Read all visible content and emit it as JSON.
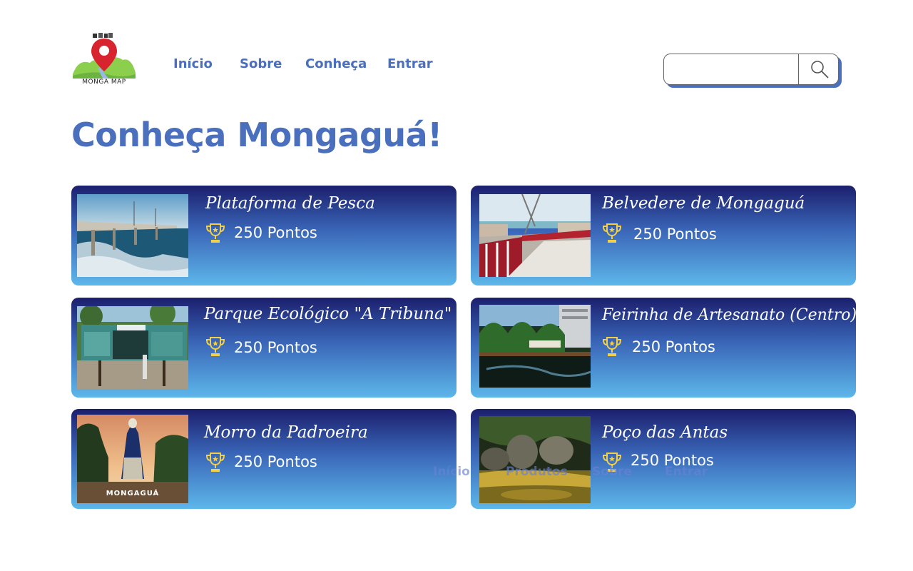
{
  "header": {
    "logo_text": "MONGA MAP",
    "nav": [
      "Início",
      "Sobre",
      "Conheça",
      "Entrar"
    ],
    "search": {
      "value": "",
      "placeholder": ""
    }
  },
  "page_title": "Conheça Mongaguá!",
  "cards": [
    {
      "name": "Plataforma de Pesca",
      "points": "250 Pontos"
    },
    {
      "name": "Belvedere de Mongaguá",
      "points": "250 Pontos"
    },
    {
      "name": "Parque Ecológico \"A Tribuna\"",
      "points": "250 Pontos"
    },
    {
      "name": "Feirinha de Artesanato (Centro)",
      "points": "250 Pontos"
    },
    {
      "name": "Morro da Padroeira",
      "points": "250 Pontos",
      "image_caption": "MONGAGUÁ"
    },
    {
      "name": "Poço das Antas",
      "points": "250 Pontos"
    }
  ],
  "ghost_nav": [
    "Início",
    "Produtos",
    "Sobre",
    "Entrar"
  ],
  "colors": {
    "accent": "#4a6fbd",
    "card_top": "#1b1f6d",
    "card_bottom": "#5db7ea",
    "trophy": "#f2d04a"
  }
}
